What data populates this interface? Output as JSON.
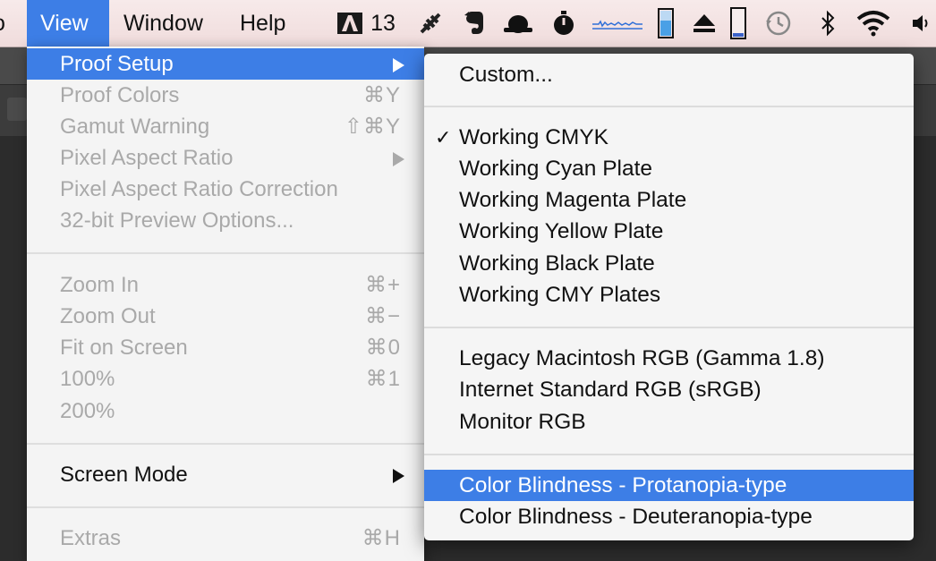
{
  "menubar": {
    "items": [
      {
        "label": "View"
      },
      {
        "label": "Window"
      },
      {
        "label": "Help"
      }
    ],
    "status": {
      "adobe_badge": "13",
      "icons": [
        "adobe-icon",
        "feather-icon",
        "evernote-icon",
        "hat-icon",
        "timer-icon",
        "audio-meter-icon",
        "battery-icon",
        "eject-icon",
        "battery-empty-icon",
        "time-machine-icon",
        "bluetooth-icon",
        "wifi-icon",
        "volume-icon"
      ]
    }
  },
  "view_menu": {
    "items": [
      {
        "label": "Proof Setup",
        "shortcut": "",
        "submenu": true,
        "state": "highlighted"
      },
      {
        "label": "Proof Colors",
        "shortcut": "⌘Y",
        "state": "disabled"
      },
      {
        "label": "Gamut Warning",
        "shortcut": "⇧⌘Y",
        "state": "disabled"
      },
      {
        "label": "Pixel Aspect Ratio",
        "shortcut": "",
        "submenu": true,
        "state": "disabled"
      },
      {
        "label": "Pixel Aspect Ratio Correction",
        "shortcut": "",
        "state": "disabled"
      },
      {
        "label": "32-bit Preview Options...",
        "shortcut": "",
        "state": "disabled"
      },
      {
        "label": "Zoom In",
        "shortcut": "⌘+",
        "state": "disabled"
      },
      {
        "label": "Zoom Out",
        "shortcut": "⌘−",
        "state": "disabled"
      },
      {
        "label": "Fit on Screen",
        "shortcut": "⌘0",
        "state": "disabled"
      },
      {
        "label": "100%",
        "shortcut": "⌘1",
        "state": "disabled"
      },
      {
        "label": "200%",
        "shortcut": "",
        "state": "disabled"
      },
      {
        "label": "Screen Mode",
        "shortcut": "",
        "submenu": true,
        "state": "enabled"
      },
      {
        "label": "Extras",
        "shortcut": "⌘H",
        "state": "disabled"
      }
    ]
  },
  "proof_submenu": {
    "items": [
      {
        "label": "Custom...",
        "checked": false
      },
      {
        "label": "Working CMYK",
        "checked": true
      },
      {
        "label": "Working Cyan Plate",
        "checked": false
      },
      {
        "label": "Working Magenta Plate",
        "checked": false
      },
      {
        "label": "Working Yellow Plate",
        "checked": false
      },
      {
        "label": "Working Black Plate",
        "checked": false
      },
      {
        "label": "Working CMY Plates",
        "checked": false
      },
      {
        "label": "Legacy Macintosh RGB (Gamma 1.8)",
        "checked": false
      },
      {
        "label": "Internet Standard RGB (sRGB)",
        "checked": false
      },
      {
        "label": "Monitor RGB",
        "checked": false
      },
      {
        "label": "Color Blindness - Protanopia-type",
        "checked": false,
        "highlighted": true
      },
      {
        "label": "Color Blindness - Deuteranopia-type",
        "checked": false
      }
    ],
    "check_glyph": "✓"
  },
  "colors": {
    "highlight": "#3d7ee6",
    "menubar_bg": "#f0dcdc",
    "disabled_text": "#a9a9a9",
    "app_bg": "#2c2c2c"
  }
}
